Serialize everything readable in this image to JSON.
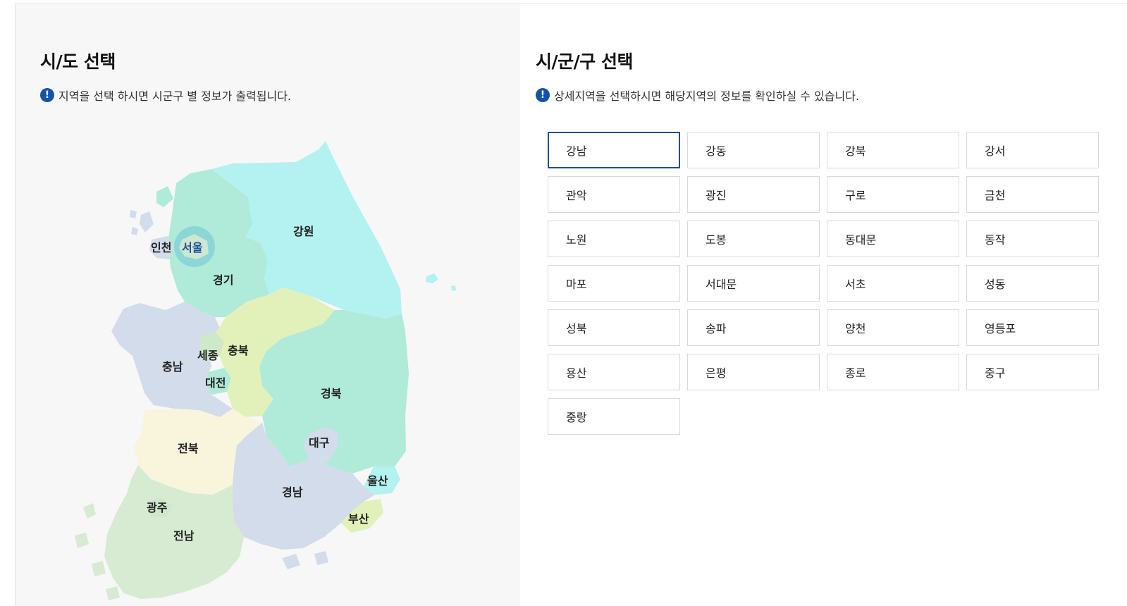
{
  "left": {
    "title": "시/도 선택",
    "notice_icon": "!",
    "notice": "지역을 선택 하시면 시군구 별 정보가 출력됩니다."
  },
  "right": {
    "title": "시/군/구 선택",
    "notice_icon": "!",
    "notice": "상세지역을 선택하시면 해당지역의 정보를 확인하실 수 있습니다."
  },
  "map": {
    "selected_region": "서울",
    "regions": [
      {
        "name": "인천",
        "color": "#d2dceb"
      },
      {
        "name": "서울",
        "color": "#cfe6cf"
      },
      {
        "name": "경기",
        "color": "#b0ead8"
      },
      {
        "name": "강원",
        "color": "#b4f1f1"
      },
      {
        "name": "충남",
        "color": "#d2dceb"
      },
      {
        "name": "세종",
        "color": "#cfe9c8"
      },
      {
        "name": "충북",
        "color": "#e2f1b9"
      },
      {
        "name": "대전",
        "color": "#b0ead8"
      },
      {
        "name": "경북",
        "color": "#b0ead8"
      },
      {
        "name": "전북",
        "color": "#f9f4dc"
      },
      {
        "name": "대구",
        "color": "#d2dceb"
      },
      {
        "name": "울산",
        "color": "#b4f1f1"
      },
      {
        "name": "광주",
        "color": "#d6ebd2"
      },
      {
        "name": "경남",
        "color": "#d2dceb"
      },
      {
        "name": "부산",
        "color": "#e2f1b9"
      },
      {
        "name": "전남",
        "color": "#d6ebd2"
      }
    ],
    "highlight_color": "#7fcfd6"
  },
  "districts": {
    "selected": "강남",
    "items": [
      "강남",
      "강동",
      "강북",
      "강서",
      "관악",
      "광진",
      "구로",
      "금천",
      "노원",
      "도봉",
      "동대문",
      "동작",
      "마포",
      "서대문",
      "서초",
      "성동",
      "성북",
      "송파",
      "양천",
      "영등포",
      "용산",
      "은평",
      "종로",
      "중구",
      "중랑"
    ]
  }
}
